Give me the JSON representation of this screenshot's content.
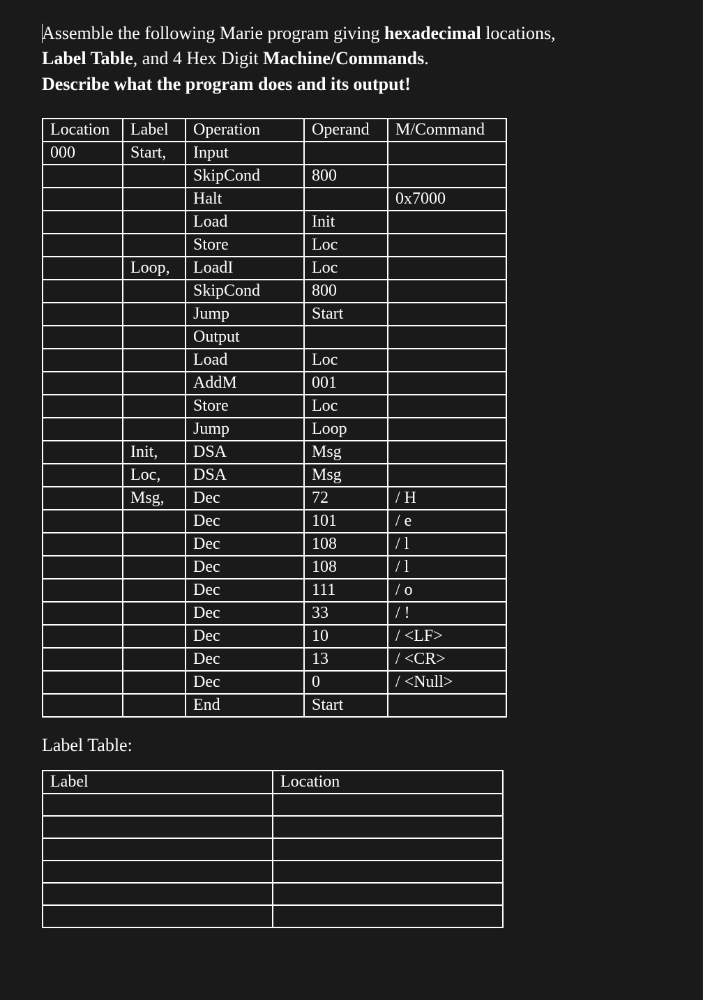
{
  "instructions": {
    "text1": "Assemble the following Marie program giving ",
    "bold1": "hexadecimal",
    "text2": " locations, ",
    "bold2": "Label Table",
    "text3": ", and 4 Hex Digit ",
    "bold3": "Machine/Commands",
    "text4": ".",
    "bold4": "Describe what the program does and its output!"
  },
  "mainTable": {
    "headers": {
      "location": "Location",
      "label": "Label",
      "operation": "Operation",
      "operand": "Operand",
      "command": "M/Command"
    },
    "rows": [
      {
        "loc": "000",
        "label": "Start,",
        "op": "Input",
        "operand": "",
        "cmd": ""
      },
      {
        "loc": "",
        "label": "",
        "op": "SkipCond",
        "operand": "800",
        "cmd": ""
      },
      {
        "loc": "",
        "label": "",
        "op": "Halt",
        "operand": "",
        "cmd": "0x7000"
      },
      {
        "loc": "",
        "label": "",
        "op": "Load",
        "operand": "Init",
        "cmd": ""
      },
      {
        "loc": "",
        "label": "",
        "op": "Store",
        "operand": "Loc",
        "cmd": ""
      },
      {
        "loc": "",
        "label": "Loop,",
        "op": "LoadI",
        "operand": "Loc",
        "cmd": ""
      },
      {
        "loc": "",
        "label": "",
        "op": "SkipCond",
        "operand": "800",
        "cmd": ""
      },
      {
        "loc": "",
        "label": "",
        "op": "Jump",
        "operand": "Start",
        "cmd": ""
      },
      {
        "loc": "",
        "label": "",
        "op": "Output",
        "operand": "",
        "cmd": ""
      },
      {
        "loc": "",
        "label": "",
        "op": "Load",
        "operand": "Loc",
        "cmd": ""
      },
      {
        "loc": "",
        "label": "",
        "op": "AddM",
        "operand": "001",
        "cmd": ""
      },
      {
        "loc": "",
        "label": "",
        "op": "Store",
        "operand": "Loc",
        "cmd": ""
      },
      {
        "loc": "",
        "label": "",
        "op": "Jump",
        "operand": "Loop",
        "cmd": ""
      },
      {
        "loc": "",
        "label": "Init,",
        "op": "DSA",
        "operand": "Msg",
        "cmd": ""
      },
      {
        "loc": "",
        "label": "Loc,",
        "op": "DSA",
        "operand": "Msg",
        "cmd": ""
      },
      {
        "loc": "",
        "label": "Msg,",
        "op": "Dec",
        "operand": "72",
        "cmd": "/ H"
      },
      {
        "loc": "",
        "label": "",
        "op": "Dec",
        "operand": "101",
        "cmd": "/ e"
      },
      {
        "loc": "",
        "label": "",
        "op": "Dec",
        "operand": "108",
        "cmd": "/ l"
      },
      {
        "loc": "",
        "label": "",
        "op": "Dec",
        "operand": "108",
        "cmd": "/ l"
      },
      {
        "loc": "",
        "label": "",
        "op": "Dec",
        "operand": "111",
        "cmd": "/ o"
      },
      {
        "loc": "",
        "label": "",
        "op": "Dec",
        "operand": "33",
        "cmd": "/ !"
      },
      {
        "loc": "",
        "label": "",
        "op": "Dec",
        "operand": "10",
        "cmd": "/ <LF>"
      },
      {
        "loc": "",
        "label": "",
        "op": "Dec",
        "operand": "13",
        "cmd": "/ <CR>"
      },
      {
        "loc": "",
        "label": "",
        "op": "Dec",
        "operand": "0",
        "cmd": "/ <Null>"
      },
      {
        "loc": "",
        "label": "",
        "op": "End",
        "operand": "Start",
        "cmd": ""
      }
    ]
  },
  "labelTable": {
    "title": "Label Table:",
    "headers": {
      "label": "Label",
      "location": "Location"
    },
    "rows": [
      {
        "label": "",
        "location": ""
      },
      {
        "label": "",
        "location": ""
      },
      {
        "label": "",
        "location": ""
      },
      {
        "label": "",
        "location": ""
      },
      {
        "label": "",
        "location": ""
      },
      {
        "label": "",
        "location": ""
      }
    ]
  }
}
